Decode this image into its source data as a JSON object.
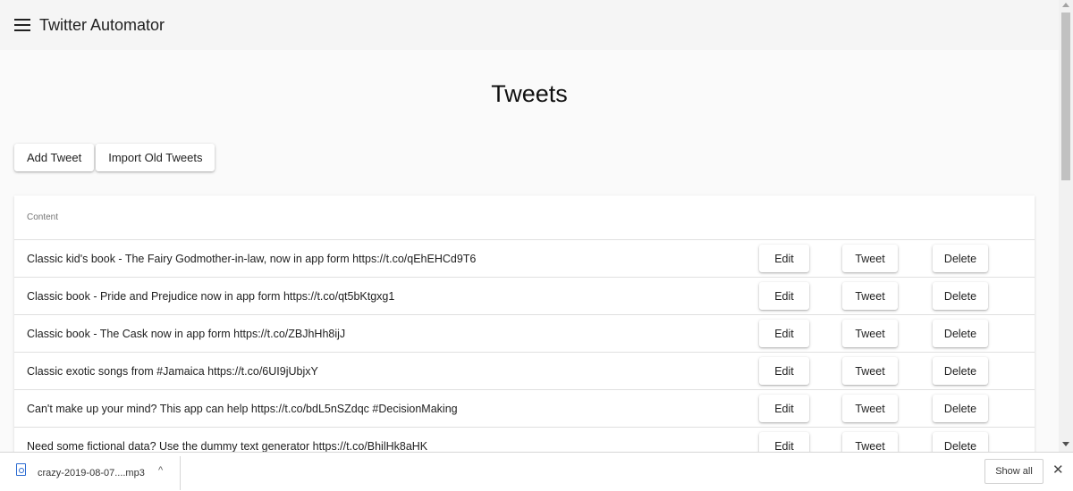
{
  "app": {
    "title": "Twitter Automator"
  },
  "page": {
    "title": "Tweets"
  },
  "toolbar": {
    "add_label": "Add Tweet",
    "import_label": "Import Old Tweets"
  },
  "table": {
    "header": "Content",
    "actions": {
      "edit": "Edit",
      "tweet": "Tweet",
      "delete": "Delete"
    },
    "rows": [
      "Classic kid's book - The Fairy Godmother-in-law, now in app form https://t.co/qEhEHCd9T6",
      "Classic book - Pride and Prejudice now in app form https://t.co/qt5bKtgxg1",
      "Classic book - The Cask now in app form https://t.co/ZBJhHh8ijJ",
      "Classic exotic songs from #Jamaica https://t.co/6UI9jUbjxY",
      "Can't make up your mind? This app can help https://t.co/bdL5nSZdqc #DecisionMaking",
      "Need some fictional data? Use the dummy text generator https://t.co/BhilHk8aHK"
    ]
  },
  "downloads": {
    "file_name": "crazy-2019-08-07....mp3",
    "show_all": "Show all",
    "chevron": "^",
    "close": "✕"
  }
}
